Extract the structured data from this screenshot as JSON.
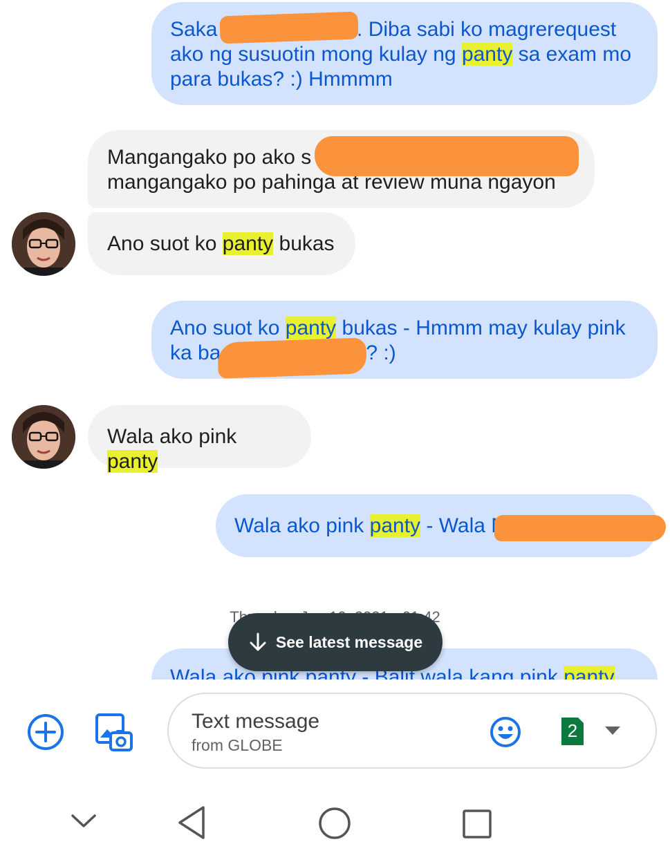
{
  "messages": [
    {
      "id": "m1",
      "dir": "out",
      "lines": [
        "Saka k.. Diba sabi ko magrerequest",
        "ako ng susuotin mong kulay ng panty sa exam mo",
        "para bukas? :) Hmmmm"
      ]
    },
    {
      "id": "m2",
      "dir": "in",
      "lines": [
        "Mangangako po ako s",
        "mangangako po pahinga at review muna ngayon"
      ]
    },
    {
      "id": "m3",
      "dir": "in",
      "pre": "Ano suot ko ",
      "hl": "panty",
      "post": " bukas"
    },
    {
      "id": "m4",
      "dir": "out",
      "line1_pre": "Ano suot ko ",
      "line1_hl": "panty",
      "line1_post": " bukas - Hmmm may kulay pink",
      "line2_pre": "ka ba",
      "line2_post": "? :)"
    },
    {
      "id": "m5",
      "dir": "in",
      "pre": "Wala ako pink ",
      "hl": "panty",
      "post": ""
    },
    {
      "id": "m6",
      "dir": "out",
      "pre": "Wala ako pink ",
      "hl": "panty",
      "post": " - Wala M"
    },
    {
      "id": "m7",
      "dir": "out",
      "pre": "Wala ako pink panty - Balit wala kang pink ",
      "hl": "panty",
      "post": ""
    }
  ],
  "msg1": {
    "a": "Saka ",
    "b": ".. Diba sabi ko magrerequest",
    "c": "ako ng susuotin mong kulay ng ",
    "hl": "panty",
    "d": " sa exam mo",
    "e": "para bukas? :) Hmmmm"
  },
  "msg2": {
    "a": "Mangangako po ako s",
    "b": "mangangako po pahinga at review muna ngayon"
  },
  "date_separator": "Thursday, Jun 10, 2021 • 01:42",
  "jump_button": {
    "label": "See latest message"
  },
  "composer": {
    "placeholder": "Text message",
    "sim_label": "from GLOBE",
    "sim_number": "2"
  },
  "colors": {
    "outgoing_bg": "#d3e3fd",
    "outgoing_text": "#0b57d0",
    "incoming_bg": "#f2f2f2",
    "highlight": "#e8f02f",
    "redaction": "#fb923c",
    "accent": "#1a73e8",
    "sim_badge": "#0b7a3e"
  },
  "icons": {
    "add": "plus-circle-icon",
    "gallery": "gallery-icon",
    "emoji": "emoji-icon",
    "sim": "sim-card-icon",
    "expand": "caret-down-icon",
    "nav_down": "chevron-down-icon",
    "nav_back": "back-triangle-icon",
    "nav_home": "home-circle-icon",
    "nav_recents": "recents-square-icon"
  }
}
